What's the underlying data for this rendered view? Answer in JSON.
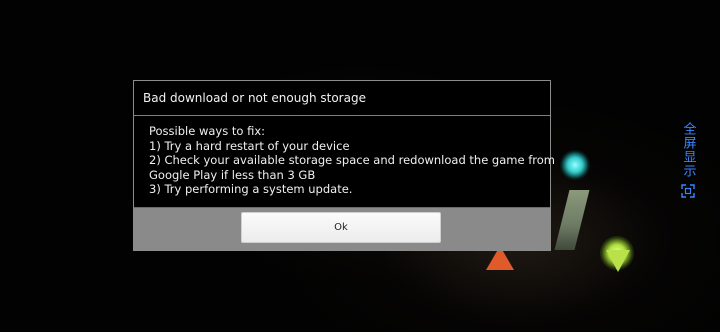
{
  "dialog": {
    "title": "Bad download or not enough storage",
    "body_lines": [
      "Possible ways to fix:",
      "1) Try a hard restart of your device",
      "2) Check your available storage space and redownload the game from",
      "Google Play if less than 3 GB",
      "3) Try performing a system update."
    ],
    "ok_label": "Ok"
  },
  "fullscreen_control": {
    "label": "全屏显示",
    "icon": "expand-icon",
    "color": "#3a86ff"
  }
}
